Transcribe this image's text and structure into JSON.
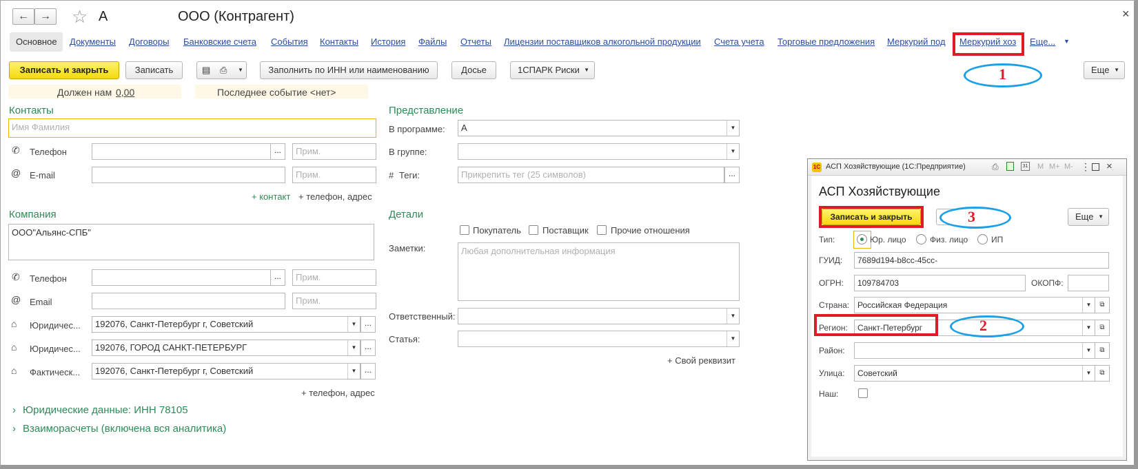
{
  "header": {
    "back_icon": "←",
    "forward_icon": "→",
    "star_icon": "☆",
    "short_name": "А",
    "title": "ООО (Контрагент)",
    "close_icon": "×"
  },
  "tabs": [
    "Основное",
    "Документы",
    "Договоры",
    "Банковские счета",
    "События",
    "Контакты",
    "История",
    "Файлы",
    "Отчеты",
    "Лицензии поставщиков алкогольной продукции",
    "Счета учета",
    "Торговые предложения",
    "Меркурий под",
    "Меркурий хоз",
    "Еще..."
  ],
  "toolbar": {
    "save_close": "Записать и закрыть",
    "save": "Записать",
    "fill_inn": "Заполнить по ИНН или наименованию",
    "dossier": "Досье",
    "spark": "1СПАРК Риски",
    "more": "Еще"
  },
  "info": {
    "owes_label": "Должен нам",
    "owes_value": "0,00",
    "last_event": "Последнее событие <нет>"
  },
  "contacts": {
    "section": "Контакты",
    "name_placeholder": "Имя Фамилия",
    "phone_label": "Телефон",
    "email_label": "E-mail",
    "note_placeholder": "Прим.",
    "add_contact": "+ контакт",
    "add_phone_addr": "+ телефон, адрес"
  },
  "company": {
    "section": "Компания",
    "name_value": "ООО\"Альянс-СПБ\"",
    "phone_label": "Телефон",
    "email_label": "Email",
    "legal1_label": "Юридичес...",
    "legal1_value": "192076, Санкт-Петербург г, Советский",
    "legal2_label": "Юридичес...",
    "legal2_value": "192076, ГОРОД САНКТ-ПЕТЕРБУРГ",
    "fact_label": "Фактическ...",
    "fact_value": "192076, Санкт-Петербург г, Советский",
    "add_phone_addr": "+ телефон, адрес"
  },
  "collapsibles": {
    "legal": "Юридические данные: ИНН 78105",
    "settlements": "Взаиморасчеты (включена вся аналитика)"
  },
  "presentation": {
    "section": "Представление",
    "in_program_label": "В программе:",
    "in_program_value": "А",
    "group_label": "В группе:",
    "tags_label": "Теги:",
    "tags_placeholder": "Прикрепить тег (25 символов)"
  },
  "details": {
    "section": "Детали",
    "buyer": "Покупатель",
    "supplier": "Поставщик",
    "other": "Прочие отношения",
    "notes_label": "Заметки:",
    "notes_placeholder": "Любая дополнительная информация",
    "responsible_label": "Ответственный:",
    "article_label": "Статья:",
    "own_req": "+ Свой реквизит"
  },
  "dialog": {
    "window_title": "АСП Хозяйствующие  (1С:Предприятие)",
    "heading": "АСП Хозяйствующие",
    "save_close": "Записать и закрыть",
    "more": "Еще",
    "type_label": "Тип:",
    "type_options": [
      "Юр. лицо",
      "Физ. лицо",
      "ИП"
    ],
    "guid_label": "ГУИД:",
    "guid_value": "7689d194-b8cc-45cc-",
    "ogrn_label": "ОГРН:",
    "ogrn_value": "109784703",
    "okopf_label": "ОКОПФ:",
    "country_label": "Страна:",
    "country_value": "Российская Федерация",
    "region_label": "Регион:",
    "region_value": "Санкт-Петербург",
    "district_label": "Район:",
    "street_label": "Улица:",
    "street_value": "Советский",
    "ours_label": "Наш:",
    "title_icons": [
      "М",
      "М+",
      "М-"
    ]
  },
  "annotations": [
    "1",
    "2",
    "3"
  ],
  "colors": {
    "accent_green": "#2e8b57",
    "link_blue": "#2a4da0",
    "highlight_red": "#e01b24",
    "ellipse_blue": "#1aa0e8",
    "button_yellow": "#f5d90e"
  }
}
